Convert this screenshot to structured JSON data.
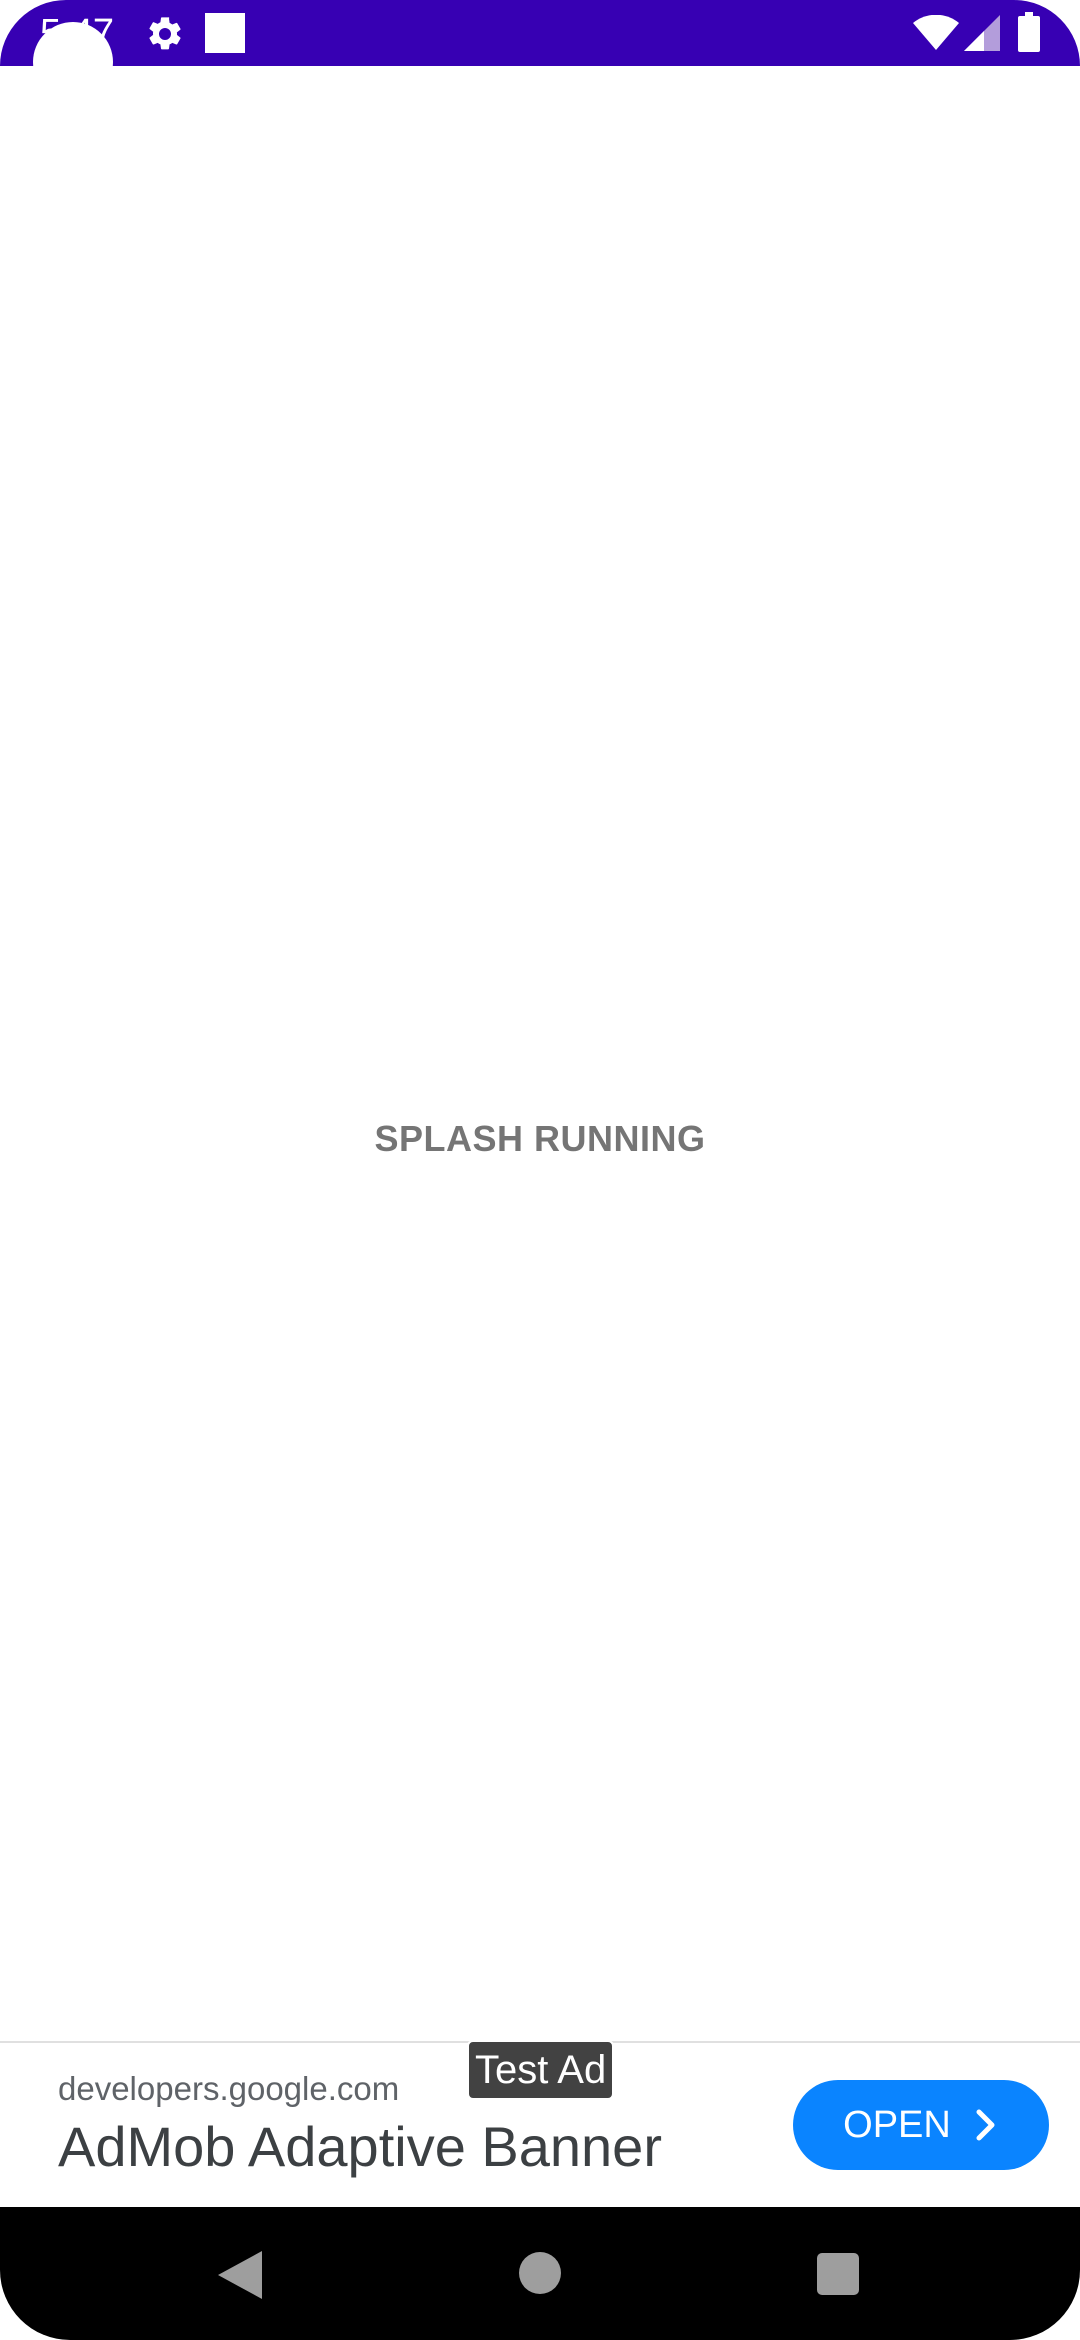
{
  "status_bar": {
    "time": "5:47",
    "icons": [
      "gear-icon",
      "notification-square-icon",
      "wifi-icon",
      "signal-icon",
      "battery-icon"
    ],
    "background_color": "#3700b3"
  },
  "main": {
    "splash_text": "SPLASH RUNNING"
  },
  "ad_banner": {
    "badge": "Test Ad",
    "domain": "developers.google.com",
    "title": "AdMob Adaptive Banner",
    "open_label": "OPEN",
    "button_color": "#0a84ff"
  },
  "nav_bar": {
    "icons": [
      "back-icon",
      "home-icon",
      "recents-icon"
    ]
  }
}
